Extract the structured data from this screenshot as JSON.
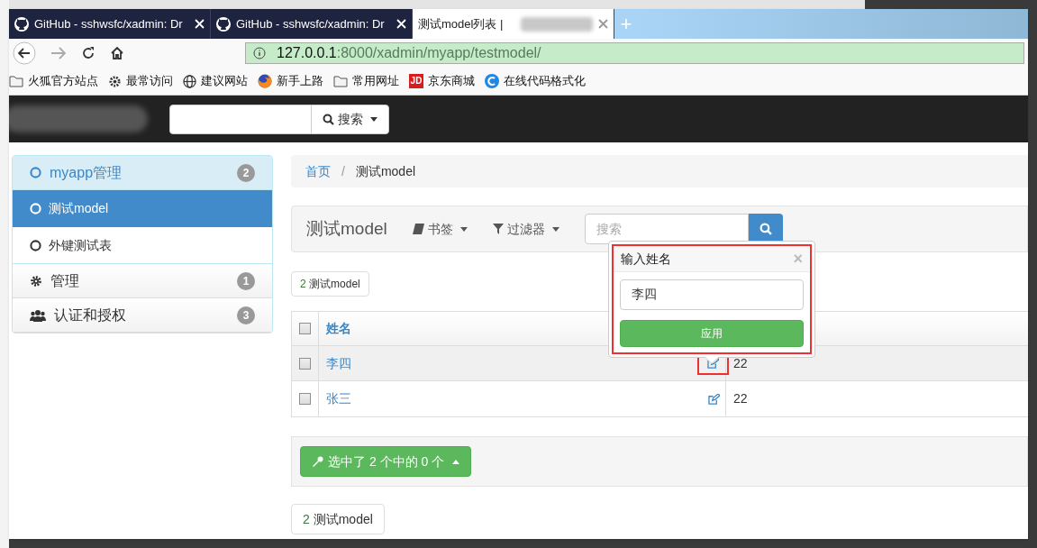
{
  "browser": {
    "tabs": [
      {
        "title": "GitHub - sshwsfc/xadmin: Dr",
        "kind": "github",
        "selected": false
      },
      {
        "title": "GitHub - sshwsfc/xadmin: Dr",
        "kind": "github",
        "selected": false
      },
      {
        "title": "测试model列表 |",
        "kind": "page",
        "selected": true
      }
    ],
    "new_tab": "+",
    "address": {
      "host": "127.0.0.1",
      "rest": ":8000/xadmin/myapp/testmodel/"
    },
    "bookmarks": [
      {
        "label": "火狐官方站点",
        "kind": "folder"
      },
      {
        "label": "最常访问",
        "kind": "gear"
      },
      {
        "label": "建议网站",
        "kind": "globe"
      },
      {
        "label": "新手上路",
        "kind": "firefox"
      },
      {
        "label": "常用网址",
        "kind": "folder"
      },
      {
        "label": "京东商城",
        "kind": "jd",
        "badge": "JD"
      },
      {
        "label": "在线代码格式化",
        "kind": "c"
      }
    ]
  },
  "navbar": {
    "search_button": "搜索"
  },
  "sidebar": {
    "groups": [
      {
        "label": "myapp管理",
        "kind": "circle",
        "count": "2",
        "expanded": true,
        "children": [
          {
            "label": "测试model",
            "selected": true
          },
          {
            "label": "外键测试表",
            "selected": false
          }
        ]
      },
      {
        "label": "管理",
        "kind": "gear",
        "count": "1",
        "expanded": false
      },
      {
        "label": "认证和授权",
        "kind": "users",
        "count": "3",
        "expanded": false
      }
    ]
  },
  "breadcrumb": [
    {
      "label": "首页",
      "kind": "link"
    },
    {
      "label": "/",
      "kind": "separator"
    },
    {
      "label": "测试model",
      "kind": "current"
    }
  ],
  "toolbar": {
    "title": "测试model",
    "bookmarks": "书签",
    "filters": "过滤器",
    "search_placeholder": "搜索"
  },
  "count_button": {
    "count": "2",
    "label": "测试model"
  },
  "table": {
    "select_all_checked": false,
    "columns": [
      "姓名"
    ],
    "rows": [
      {
        "name": "李四",
        "column_3": "22",
        "checked": false,
        "hovered": true,
        "annotated": true
      },
      {
        "name": "张三",
        "column_3": "22",
        "checked": false,
        "hovered": false,
        "annotated": false
      }
    ]
  },
  "actions_button": "选中了 2 个中的 0 个",
  "footer_count": {
    "count": "2",
    "label": "测试model"
  },
  "popover": {
    "title": "输入姓名",
    "close": "×",
    "value": "李四",
    "apply": "应用",
    "annotated": true
  }
}
